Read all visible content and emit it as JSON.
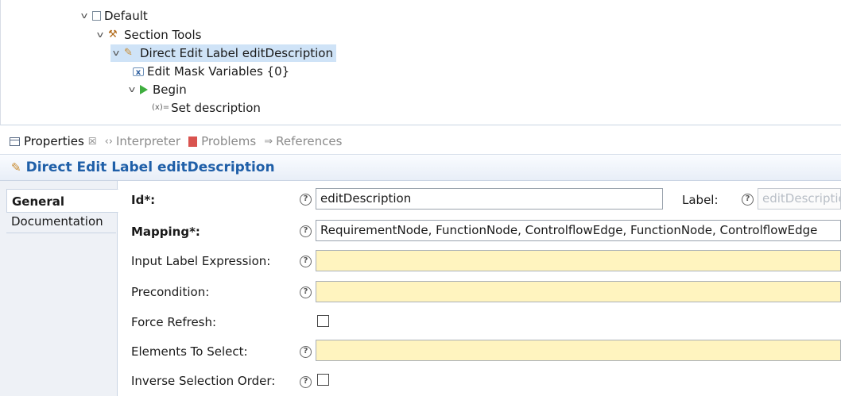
{
  "tree": {
    "items": [
      {
        "label": "Default",
        "icon": "default-icon"
      },
      {
        "label": "Section Tools",
        "icon": "tools-icon"
      },
      {
        "label": "Direct Edit Label editDescription",
        "icon": "pencil-icon"
      },
      {
        "label": "Edit Mask Variables {0}",
        "icon": "mask-icon"
      },
      {
        "label": "Begin",
        "icon": "begin-icon"
      },
      {
        "label": "Set description",
        "icon": "set-icon"
      }
    ],
    "set_icon_text": "(x)="
  },
  "tabs": [
    {
      "label": "Properties",
      "close": "☒"
    },
    {
      "label": "Interpreter"
    },
    {
      "label": "Problems"
    },
    {
      "label": "References"
    }
  ],
  "header": {
    "title": "Direct Edit Label editDescription"
  },
  "sidetabs": [
    {
      "label": "General"
    },
    {
      "label": "Documentation"
    }
  ],
  "form": {
    "id": {
      "label": "Id*:",
      "value": "editDescription"
    },
    "label": {
      "label": "Label:",
      "value": "editDescriptio"
    },
    "mapping": {
      "label": "Mapping*:",
      "value": "RequirementNode, FunctionNode, ControlflowEdge, FunctionNode, ControlflowEdge"
    },
    "input_label_expression": {
      "label": "Input Label Expression:",
      "value": ""
    },
    "precondition": {
      "label": "Precondition:",
      "value": ""
    },
    "force_refresh": {
      "label": "Force Refresh:",
      "checked": false
    },
    "elements_to_select": {
      "label": "Elements To Select:",
      "value": ""
    },
    "inverse_selection_order": {
      "label": "Inverse Selection Order:",
      "checked": false
    }
  },
  "help_glyph": "?",
  "colors": {
    "accent": "#1f5fa8",
    "selection": "#cfe3f7",
    "expression_field": "#fff4bf"
  }
}
